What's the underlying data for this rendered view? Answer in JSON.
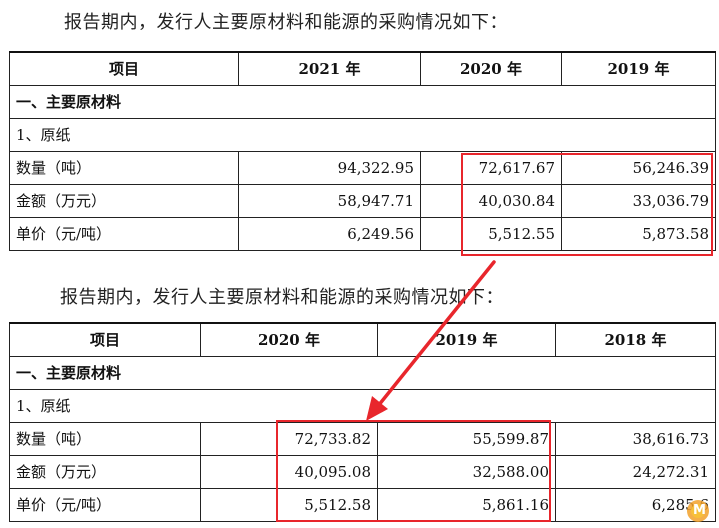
{
  "intro_top": "报告期内，发行人主要原材料和能源的采购情况如下：",
  "intro_bottom": "报告期内，发行人主要原材料和能源的采购情况如下：",
  "table_top": {
    "headers": [
      "项目",
      "2021 年",
      "2020 年",
      "2019 年"
    ],
    "section": "一、主要原材料",
    "sub": "1、原纸",
    "rows": [
      {
        "label": "数量（吨）",
        "values": [
          "94,322.95",
          "72,617.67",
          "56,246.39"
        ]
      },
      {
        "label": "金额（万元）",
        "values": [
          "58,947.71",
          "40,030.84",
          "33,036.79"
        ]
      },
      {
        "label": "单价（元/吨）",
        "values": [
          "6,249.56",
          "5,512.55",
          "5,873.58"
        ]
      }
    ]
  },
  "table_bottom": {
    "headers": [
      "项目",
      "2020 年",
      "2019 年",
      "2018 年"
    ],
    "section": "一、主要原材料",
    "sub": "1、原纸",
    "rows": [
      {
        "label": "数量（吨）",
        "values": [
          "72,733.82",
          "55,599.87",
          "38,616.73"
        ]
      },
      {
        "label": "金额（万元）",
        "values": [
          "40,095.08",
          "32,588.00",
          "24,272.31"
        ]
      },
      {
        "label": "单价（元/吨）",
        "values": [
          "5,512.58",
          "5,861.16",
          "6,285.6"
        ]
      }
    ]
  },
  "highlight_color": "#e8262c",
  "watermark": {
    "icon": "logo-badge-icon",
    "text": "M"
  }
}
